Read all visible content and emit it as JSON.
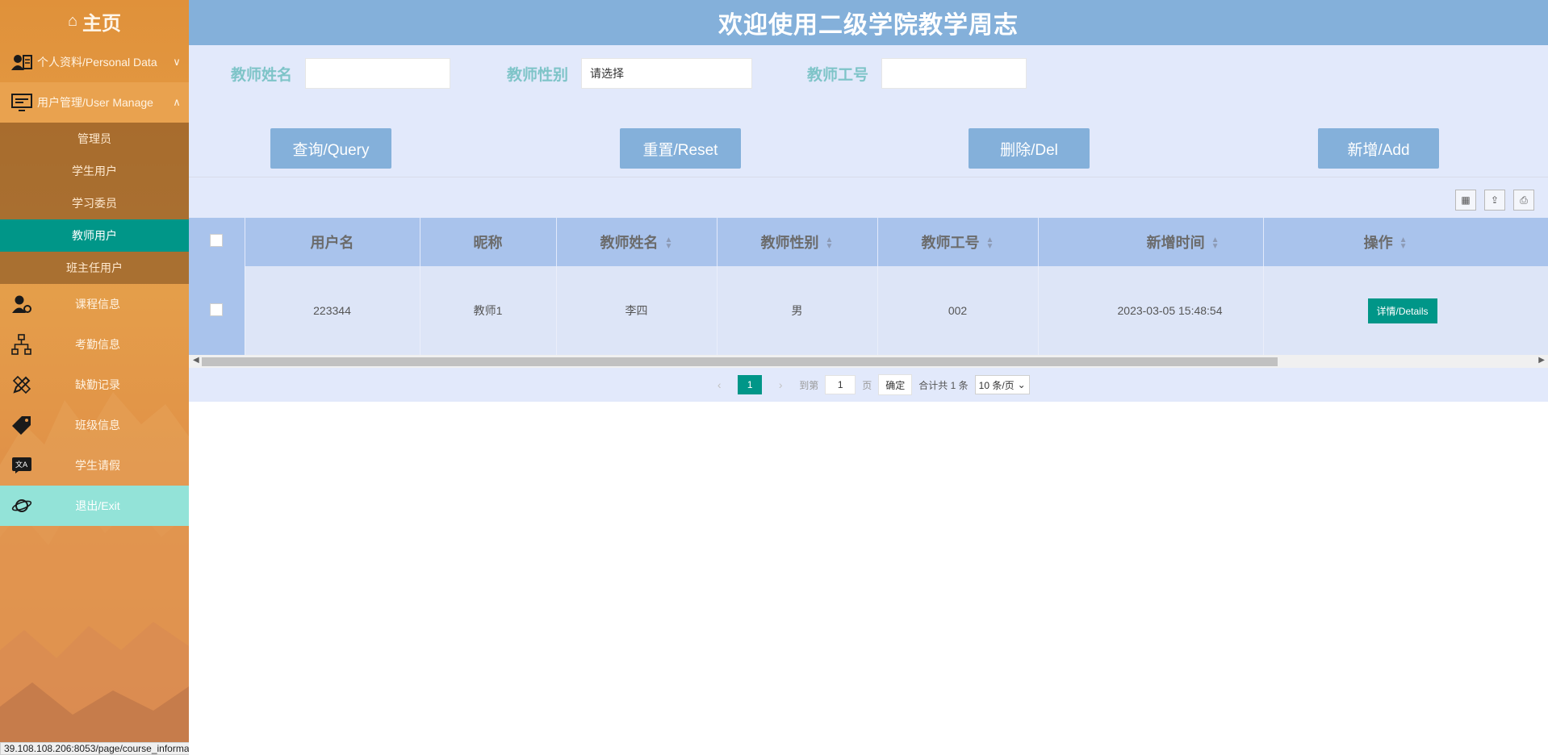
{
  "sidebar": {
    "home_label": "主页",
    "menu": [
      {
        "label": "个人资料/Personal Data",
        "icon": "user-card-icon"
      },
      {
        "label": "用户管理/User Manage",
        "icon": "monitor-icon"
      }
    ],
    "submenu": [
      {
        "label": "管理员",
        "active": false
      },
      {
        "label": "学生用户",
        "active": false
      },
      {
        "label": "学习委员",
        "active": false
      },
      {
        "label": "教师用户",
        "active": true
      },
      {
        "label": "班主任用户",
        "active": false
      }
    ],
    "items": [
      {
        "label": "课程信息",
        "icon": "user-gear-icon"
      },
      {
        "label": "考勤信息",
        "icon": "org-chart-icon"
      },
      {
        "label": "缺勤记录",
        "icon": "pencil-ruler-icon"
      },
      {
        "label": "班级信息",
        "icon": "tag-icon"
      },
      {
        "label": "学生请假",
        "icon": "translate-icon"
      },
      {
        "label": "退出/Exit",
        "icon": "planet-icon"
      }
    ],
    "status_url": "39.108.108.206:8053/page/course_information/table.jsp"
  },
  "header": {
    "title": "欢迎使用二级学院教学周志"
  },
  "filters": {
    "name_label": "教师姓名",
    "name_value": "",
    "gender_label": "教师性别",
    "gender_placeholder": "请选择",
    "id_label": "教师工号",
    "id_value": ""
  },
  "actions": {
    "query": "查询/Query",
    "reset": "重置/Reset",
    "delete": "删除/Del",
    "add": "新增/Add"
  },
  "table": {
    "columns": [
      "用户名",
      "昵称",
      "教师姓名",
      "教师性别",
      "教师工号",
      "新增时间",
      "操作"
    ],
    "rows": [
      {
        "username": "223344",
        "nickname": "教师1",
        "name": "李四",
        "gender": "男",
        "id": "002",
        "created": "2023-03-05 15:48:54",
        "action": "详情/Details"
      }
    ]
  },
  "pagination": {
    "current_page": "1",
    "goto_label": "到第",
    "goto_value": "1",
    "page_unit": "页",
    "confirm": "确定",
    "total": "合计共 1 条",
    "page_size": "10 条/页"
  },
  "colors": {
    "sidebar": "#e29548",
    "header": "#84b0da",
    "panel": "#e2e9fb",
    "accent": "#009688"
  }
}
